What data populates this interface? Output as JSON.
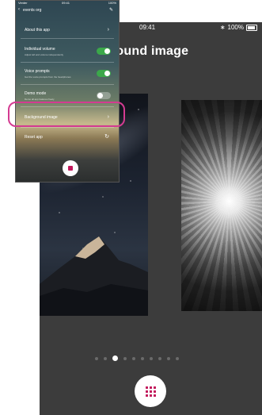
{
  "main": {
    "status_time": "09:41",
    "status_battery": "100%",
    "title": "ground image",
    "pagination": {
      "count": 10,
      "active_index": 3
    }
  },
  "inset": {
    "status_left": "Venter",
    "status_center": "09:41",
    "status_right": "100%",
    "header_title": "events org",
    "rows": {
      "about": {
        "label": "About this app"
      },
      "volume": {
        "label": "Individual volume",
        "sub": "Adjust left and volume independently"
      },
      "voice": {
        "label": "Voice prompts",
        "sub": "Get the voice prompts from the headphones"
      },
      "demo": {
        "label": "Demo mode",
        "sub": "Demo all app features freely"
      },
      "background": {
        "label": "Background image"
      },
      "reset": {
        "label": "Reset app"
      }
    }
  },
  "colors": {
    "accent": "#c2185b",
    "highlight": "#d43b91",
    "toggle_on": "#3ba84a"
  }
}
